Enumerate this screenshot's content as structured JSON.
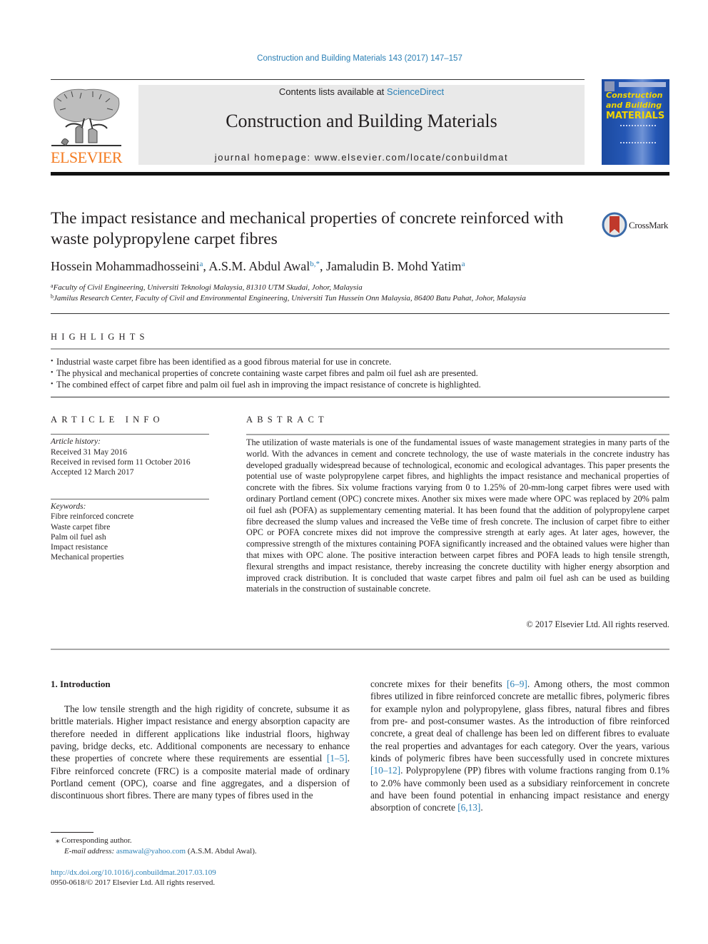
{
  "journal_reference": "Construction and Building Materials 143 (2017) 147–157",
  "header": {
    "publisher_wordmark": "ELSEVIER",
    "contents_prefix": "Contents lists available at ",
    "contents_link": "ScienceDirect",
    "journal_name": "Construction and Building Materials",
    "homepage_line": "journal homepage: www.elsevier.com/locate/conbuildmat",
    "cover": {
      "line1": "Construction",
      "line2": "and Building",
      "line3": "MATERIALS"
    }
  },
  "article": {
    "title": "The impact resistance and mechanical properties of concrete reinforced with waste polypropylene carpet fibres",
    "crossmark_label": "CrossMark",
    "authors": [
      {
        "name": "Hossein Mohammadhosseini",
        "sup": "a",
        "sep": ", "
      },
      {
        "name": "A.S.M. Abdul Awal",
        "sup": "b,*",
        "sep": ", "
      },
      {
        "name": "Jamaludin B. Mohd Yatim",
        "sup": "a",
        "sep": ""
      }
    ],
    "affiliations": [
      {
        "key": "a",
        "text": "Faculty of Civil Engineering, Universiti Teknologi Malaysia, 81310 UTM Skudai, Johor, Malaysia"
      },
      {
        "key": "b",
        "text": "Jamilus Research Center, Faculty of Civil and Environmental Engineering, Universiti Tun Hussein Onn Malaysia, 86400 Batu Pahat, Johor, Malaysia"
      }
    ]
  },
  "highlights": {
    "heading": "HIGHLIGHTS",
    "items": [
      "Industrial waste carpet fibre has been identified as a good fibrous material for use in concrete.",
      "The physical and mechanical properties of concrete containing waste carpet fibres and palm oil fuel ash are presented.",
      "The combined effect of carpet fibre and palm oil fuel ash in improving the impact resistance of concrete is highlighted."
    ]
  },
  "article_info": {
    "heading": "ARTICLE INFO",
    "history_label": "Article history:",
    "history": [
      "Received 31 May 2016",
      "Received in revised form 11 October 2016",
      "Accepted 12 March 2017"
    ],
    "keywords_label": "Keywords:",
    "keywords": [
      "Fibre reinforced concrete",
      "Waste carpet fibre",
      "Palm oil fuel ash",
      "Impact resistance",
      "Mechanical properties"
    ]
  },
  "abstract": {
    "heading": "ABSTRACT",
    "text": "The utilization of waste materials is one of the fundamental issues of waste management strategies in many parts of the world. With the advances in cement and concrete technology, the use of waste materials in the concrete industry has developed gradually widespread because of technological, economic and ecological advantages. This paper presents the potential use of waste polypropylene carpet fibres, and highlights the impact resistance and mechanical properties of concrete with the fibres. Six volume fractions varying from 0 to 1.25% of 20-mm-long carpet fibres were used with ordinary Portland cement (OPC) concrete mixes. Another six mixes were made where OPC was replaced by 20% palm oil fuel ash (POFA) as supplementary cementing material. It has been found that the addition of polypropylene carpet fibre decreased the slump values and increased the VeBe time of fresh concrete. The inclusion of carpet fibre to either OPC or POFA concrete mixes did not improve the compressive strength at early ages. At later ages, however, the compressive strength of the mixtures containing POFA significantly increased and the obtained values were higher than that mixes with OPC alone. The positive interaction between carpet fibres and POFA leads to high tensile strength, flexural strengths and impact resistance, thereby increasing the concrete ductility with higher energy absorption and improved crack distribution. It is concluded that waste carpet fibres and palm oil fuel ash can be used as building materials in the construction of sustainable concrete.",
    "copyright": "© 2017 Elsevier Ltd. All rights reserved."
  },
  "introduction": {
    "heading": "1. Introduction",
    "col1": [
      {
        "t": "The low tensile strength and the high rigidity of concrete, subsume it as brittle materials. Higher impact resistance and energy absorption capacity are therefore needed in different applications like industrial floors, highway paving, bridge decks, etc. Additional components are necessary to enhance these properties of concrete where these requirements are essential "
      },
      {
        "ref": "[1–5]"
      },
      {
        "t": ". Fibre reinforced concrete (FRC) is a composite material made of ordinary Portland cement (OPC), coarse and fine aggregates, and a dispersion of discontinuous short fibres. There are many types of fibres used in the"
      }
    ],
    "col2": [
      {
        "t": "concrete mixes for their benefits "
      },
      {
        "ref": "[6–9]"
      },
      {
        "t": ". Among others, the most common fibres utilized in fibre reinforced concrete are metallic fibres, polymeric fibres for example nylon and polypropylene, glass fibres, natural fibres and fibres from pre- and post-consumer wastes. As the introduction of fibre reinforced concrete, a great deal of challenge has been led on different fibres to evaluate the real properties and advantages for each category. Over the years, various kinds of polymeric fibres have been successfully used in concrete mixtures "
      },
      {
        "ref": "[10–12]"
      },
      {
        "t": ". Polypropylene (PP) fibres with volume fractions ranging from 0.1% to 2.0% have commonly been used as a subsidiary reinforcement in concrete and have been found potential in enhancing impact resistance and energy absorption of concrete "
      },
      {
        "ref": "[6,13]"
      },
      {
        "t": "."
      }
    ]
  },
  "footnotes": {
    "corresponding_marker": "⁎",
    "corresponding_text": "Corresponding author.",
    "email_label": "E-mail address:",
    "email": "asmawal@yahoo.com",
    "email_owner": "(A.S.M. Abdul Awal).",
    "doi": "http://dx.doi.org/10.1016/j.conbuildmat.2017.03.109",
    "issn_line": "0950-0618/© 2017 Elsevier Ltd. All rights reserved."
  },
  "colors": {
    "link": "#2a7fb5",
    "elsevier_orange": "#f47b20",
    "header_box": "#e9e9e9",
    "cover_blue": "#2557b5",
    "cover_yellow": "#f2d500",
    "crossmark_red": "#c0392b"
  }
}
